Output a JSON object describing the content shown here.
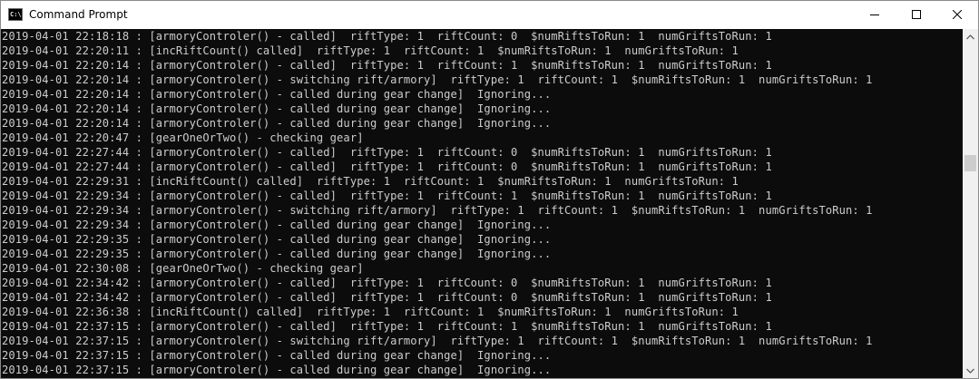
{
  "window": {
    "title": "Command Prompt",
    "icon": "cmd-icon",
    "icon_glyph": "C:\\"
  },
  "controls": {
    "minimize_icon": "minimize-icon",
    "maximize_icon": "maximize-icon",
    "close_icon": "close-icon"
  },
  "console": {
    "background": "#0c0c0c",
    "text_color": "#cccccc",
    "lines": [
      "2019-04-01 22:18:18 : [armoryControler() - called]  riftType: 1  riftCount: 0  $numRiftsToRun: 1  numGriftsToRun: 1",
      "2019-04-01 22:20:11 : [incRiftCount() called]  riftType: 1  riftCount: 1  $numRiftsToRun: 1  numGriftsToRun: 1",
      "2019-04-01 22:20:14 : [armoryControler() - called]  riftType: 1  riftCount: 1  $numRiftsToRun: 1  numGriftsToRun: 1",
      "2019-04-01 22:20:14 : [armoryControler() - switching rift/armory]  riftType: 1  riftCount: 1  $numRiftsToRun: 1  numGriftsToRun: 1",
      "2019-04-01 22:20:14 : [armoryControler() - called during gear change]  Ignoring...",
      "2019-04-01 22:20:14 : [armoryControler() - called during gear change]  Ignoring...",
      "2019-04-01 22:20:14 : [armoryControler() - called during gear change]  Ignoring...",
      "2019-04-01 22:20:47 : [gearOneOrTwo() - checking gear]",
      "2019-04-01 22:27:44 : [armoryControler() - called]  riftType: 1  riftCount: 0  $numRiftsToRun: 1  numGriftsToRun: 1",
      "2019-04-01 22:27:44 : [armoryControler() - called]  riftType: 1  riftCount: 0  $numRiftsToRun: 1  numGriftsToRun: 1",
      "2019-04-01 22:29:31 : [incRiftCount() called]  riftType: 1  riftCount: 1  $numRiftsToRun: 1  numGriftsToRun: 1",
      "2019-04-01 22:29:34 : [armoryControler() - called]  riftType: 1  riftCount: 1  $numRiftsToRun: 1  numGriftsToRun: 1",
      "2019-04-01 22:29:34 : [armoryControler() - switching rift/armory]  riftType: 1  riftCount: 1  $numRiftsToRun: 1  numGriftsToRun: 1",
      "2019-04-01 22:29:34 : [armoryControler() - called during gear change]  Ignoring...",
      "2019-04-01 22:29:35 : [armoryControler() - called during gear change]  Ignoring...",
      "2019-04-01 22:29:35 : [armoryControler() - called during gear change]  Ignoring...",
      "2019-04-01 22:30:08 : [gearOneOrTwo() - checking gear]",
      "2019-04-01 22:34:42 : [armoryControler() - called]  riftType: 1  riftCount: 0  $numRiftsToRun: 1  numGriftsToRun: 1",
      "2019-04-01 22:34:42 : [armoryControler() - called]  riftType: 1  riftCount: 0  $numRiftsToRun: 1  numGriftsToRun: 1",
      "2019-04-01 22:36:38 : [incRiftCount() called]  riftType: 1  riftCount: 1  $numRiftsToRun: 1  numGriftsToRun: 1",
      "2019-04-01 22:37:15 : [armoryControler() - called]  riftType: 1  riftCount: 1  $numRiftsToRun: 1  numGriftsToRun: 1",
      "2019-04-01 22:37:15 : [armoryControler() - switching rift/armory]  riftType: 1  riftCount: 1  $numRiftsToRun: 1  numGriftsToRun: 1",
      "2019-04-01 22:37:15 : [armoryControler() - called during gear change]  Ignoring...",
      "2019-04-01 22:37:15 : [armoryControler() - called during gear change]  Ignoring..."
    ]
  },
  "scrollbar": {
    "up_icon": "scroll-up-arrow-icon",
    "down_icon": "scroll-down-arrow-icon"
  }
}
